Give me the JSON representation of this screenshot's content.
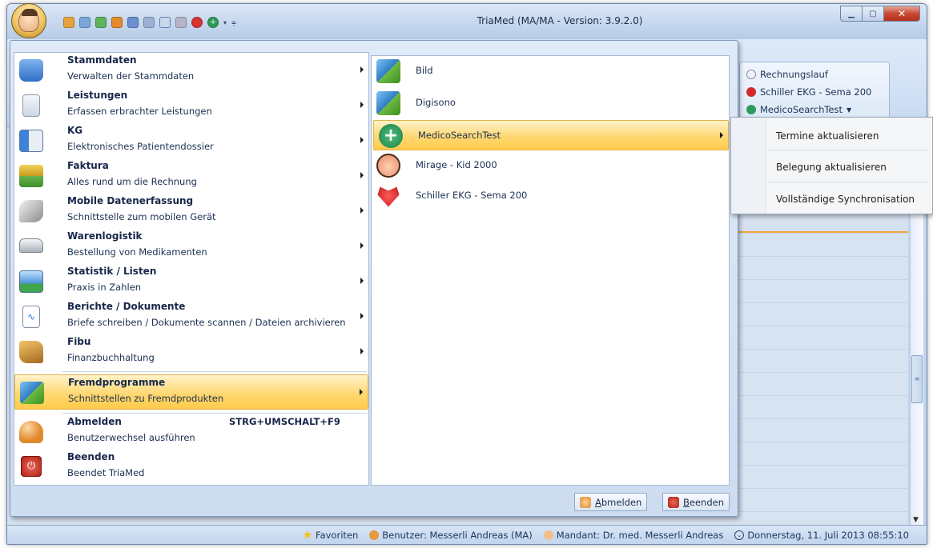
{
  "window": {
    "title": "TriaMed (MA/MA - Version: 3.9.2.0)",
    "controls": {
      "minimize": "▁",
      "maximize": "▢",
      "close": "✕"
    }
  },
  "ribbon_background": {
    "items": [
      "Rechnungslauf",
      "Schiller EKG - Sema 200",
      "MedicoSearchTest"
    ]
  },
  "menu": {
    "items": [
      {
        "title": "Stammdaten",
        "desc": "Verwalten der Stammdaten",
        "icon": "database-icon"
      },
      {
        "title": "Leistungen",
        "desc": "Erfassen erbrachter Leistungen",
        "icon": "document-list-icon"
      },
      {
        "title": "KG",
        "desc": "Elektronisches Patientendossier",
        "icon": "patient-card-icon"
      },
      {
        "title": "Faktura",
        "desc": "Alles rund um die Rechnung",
        "icon": "coins-icon"
      },
      {
        "title": "Mobile Datenerfassung",
        "desc": "Schnittstelle zum mobilen Gerät",
        "icon": "pen-device-icon"
      },
      {
        "title": "Warenlogistik",
        "desc": "Bestellung von Medikamenten",
        "icon": "van-icon"
      },
      {
        "title": "Statistik / Listen",
        "desc": "Praxis in Zahlen",
        "icon": "chart-icon"
      },
      {
        "title": "Berichte / Dokumente",
        "desc": "Briefe schreiben / Dokumente scannen / Dateien archivieren",
        "icon": "report-document-icon"
      },
      {
        "title": "Fibu",
        "desc": "Finanzbuchhaltung",
        "icon": "ledger-icon"
      },
      {
        "title": "Fremdprogramme",
        "desc": "Schnittstellen zu Fremdprodukten",
        "icon": "puzzle-icon"
      },
      {
        "title": "Abmelden",
        "desc": "Benutzerwechsel ausführen",
        "shortcut": "STRG+UMSCHALT+F9",
        "icon": "user-lock-icon"
      },
      {
        "title": "Beenden",
        "desc": "Beendet TriaMed",
        "icon": "power-icon"
      }
    ]
  },
  "submenu": {
    "items": [
      {
        "label": "Bild",
        "icon": "puzzle-icon"
      },
      {
        "label": "Digisono",
        "icon": "puzzle-icon"
      },
      {
        "label": "MedicoSearchTest",
        "icon": "medical-cross-icon"
      },
      {
        "label": "Mirage - Kid 2000",
        "icon": "baby-face-icon"
      },
      {
        "label": "Schiller EKG - Sema 200",
        "icon": "heart-ecg-icon"
      }
    ]
  },
  "flyout": {
    "items": [
      "Termine aktualisieren",
      "Belegung aktualisieren",
      "Vollständige Synchronisation"
    ]
  },
  "footer": {
    "logout_prefix": "A",
    "logout_rest": "bmelden",
    "exit_prefix": "B",
    "exit_rest": "eenden"
  },
  "status": {
    "favorites": "Favoriten",
    "user": "Benutzer: Messerli Andreas  (MA)",
    "mandant": "Mandant: Dr. med. Messerli Andreas",
    "date": "Donnerstag, 11. Juli 2013 08:55:10"
  }
}
